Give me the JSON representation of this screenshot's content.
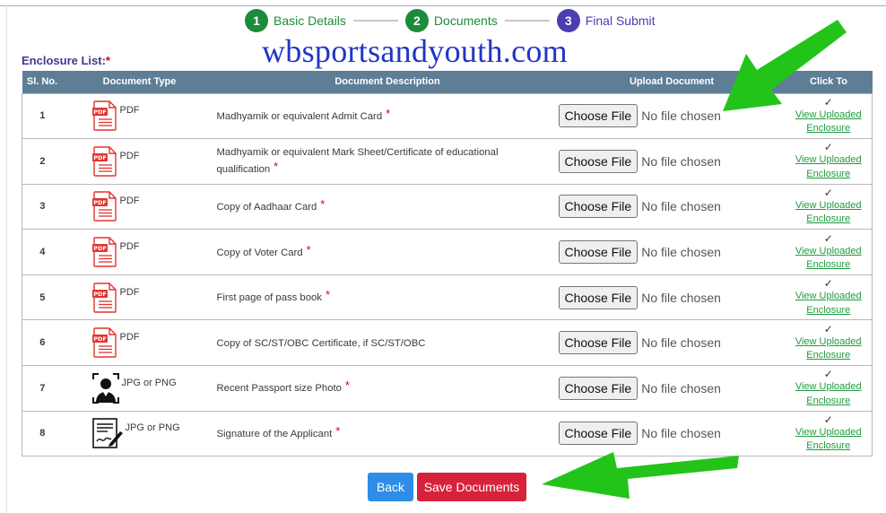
{
  "stepper": {
    "steps": [
      {
        "num": "1",
        "label": "Basic Details"
      },
      {
        "num": "2",
        "label": "Documents"
      },
      {
        "num": "3",
        "label": "Final Submit"
      }
    ]
  },
  "watermark": "wbsportsandyouth.com",
  "enclosure": {
    "title": "Enclosure List:",
    "required_mark": "*"
  },
  "table": {
    "headers": {
      "sl": "Sl. No.",
      "type": "Document Type",
      "desc": "Document Description",
      "upload": "Upload Document",
      "click": "Click To"
    },
    "rows": [
      {
        "sl": "1",
        "type": "PDF",
        "icon": "pdf-icon",
        "desc": "Madhyamik or equivalent Admit Card",
        "required": "*"
      },
      {
        "sl": "2",
        "type": "PDF",
        "icon": "pdf-icon",
        "desc": "Madhyamik or equivalent Mark Sheet/Certificate of educational qualification",
        "required": "*"
      },
      {
        "sl": "3",
        "type": "PDF",
        "icon": "pdf-icon",
        "desc": "Copy of Aadhaar Card",
        "required": "*"
      },
      {
        "sl": "4",
        "type": "PDF",
        "icon": "pdf-icon",
        "desc": "Copy of Voter Card",
        "required": "*"
      },
      {
        "sl": "5",
        "type": "PDF",
        "icon": "pdf-icon",
        "desc": "First page of pass book",
        "required": "*"
      },
      {
        "sl": "6",
        "type": "PDF",
        "icon": "pdf-icon",
        "desc": "Copy of SC/ST/OBC Certificate, if SC/ST/OBC",
        "required": ""
      },
      {
        "sl": "7",
        "type": "JPG or PNG",
        "icon": "photo-icon",
        "desc": "Recent Passport size Photo",
        "required": "*"
      },
      {
        "sl": "8",
        "type": "JPG or PNG",
        "icon": "signature-icon",
        "desc": "Signature of the Applicant",
        "required": "*"
      }
    ],
    "upload": {
      "button": "Choose File",
      "status": "No file chosen"
    },
    "click": {
      "tick": "✓",
      "link_line1": "View Uploaded",
      "link_line2": "Enclosure"
    }
  },
  "buttons": {
    "back": "Back",
    "save": "Save Documents"
  },
  "colors": {
    "step_done": "#1c8c3a",
    "step_active": "#4b3fb0",
    "header_bg": "#5e7e96",
    "link": "#1f9c3d",
    "required": "#d0021b",
    "back_btn": "#2e8de6",
    "save_btn": "#d7223b",
    "arrow": "#22c41a"
  }
}
